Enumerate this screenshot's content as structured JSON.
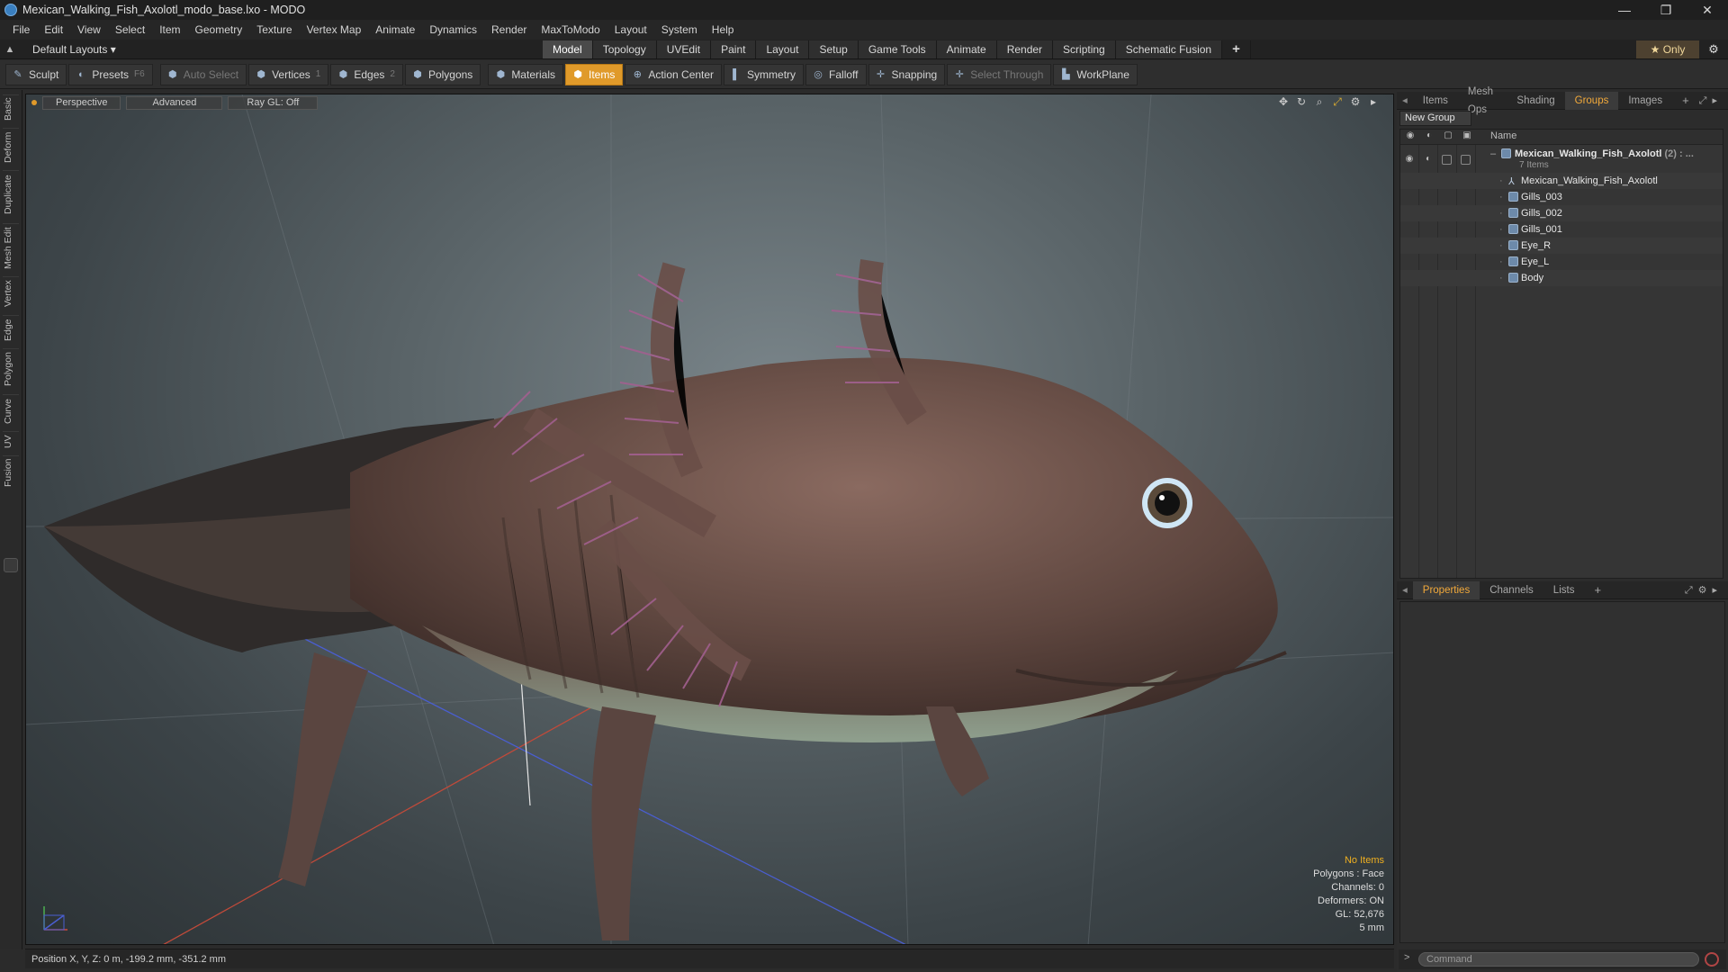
{
  "window": {
    "title": "Mexican_Walking_Fish_Axolotl_modo_base.lxo - MODO",
    "controls": [
      "—",
      "❐",
      "✕"
    ]
  },
  "menu": [
    "File",
    "Edit",
    "View",
    "Select",
    "Item",
    "Geometry",
    "Texture",
    "Vertex Map",
    "Animate",
    "Dynamics",
    "Render",
    "MaxToModo",
    "Layout",
    "System",
    "Help"
  ],
  "layout": {
    "dropdown": "Default Layouts ▾",
    "tabs": [
      "Model",
      "Topology",
      "UVEdit",
      "Paint",
      "Layout",
      "Setup",
      "Game Tools",
      "Animate",
      "Render",
      "Scripting",
      "Schematic Fusion"
    ],
    "active_tab": "Model",
    "plus": "+",
    "only": "★ Only"
  },
  "toolbar": {
    "sculpt": "Sculpt",
    "presets": "Presets",
    "presets_key": "F6",
    "auto_select": "Auto Select",
    "vertices": "Vertices",
    "vertices_count": "1",
    "edges": "Edges",
    "edges_count": "2",
    "polygons": "Polygons",
    "materials": "Materials",
    "items": "Items",
    "action_center": "Action Center",
    "symmetry": "Symmetry",
    "falloff": "Falloff",
    "snapping": "Snapping",
    "select_through": "Select Through",
    "workplane": "WorkPlane"
  },
  "left_tabs": [
    "Basic",
    "Deform",
    "Duplicate",
    "Mesh Edit",
    "Vertex",
    "Edge",
    "Polygon",
    "Curve",
    "UV",
    "Fusion"
  ],
  "viewport": {
    "perspective": "Perspective",
    "advanced": "Advanced",
    "raygl": "Ray GL: Off",
    "stats": {
      "no_items": "No Items",
      "polygons": "Polygons : Face",
      "channels": "Channels: 0",
      "deformers": "Deformers: ON",
      "gl": "GL: 52,676",
      "unit": "5 mm"
    }
  },
  "status": {
    "position": "Position X, Y, Z:  0 m, -199.2 mm, -351.2 mm"
  },
  "right_panel": {
    "top_tabs": [
      "Items",
      "Mesh Ops",
      "Shading",
      "Groups",
      "Images"
    ],
    "active_top": "Groups",
    "new_group": "New Group",
    "name_header": "Name",
    "group": {
      "name": "Mexican_Walking_Fish_Axolotl",
      "count": "(2) : ...",
      "items_label": "7 Items"
    },
    "children": [
      "Mexican_Walking_Fish_Axolotl",
      "Gills_003",
      "Gills_002",
      "Gills_001",
      "Eye_R",
      "Eye_L",
      "Body"
    ],
    "bottom_tabs": [
      "Properties",
      "Channels",
      "Lists"
    ],
    "active_bottom": "Properties",
    "command_placeholder": "Command"
  },
  "colors": {
    "accent": "#f2a93b",
    "active_tool": "#e09a2a",
    "stat_warning": "#f0b020",
    "axolotl_body": "#6a5048",
    "axolotl_gills": "#9a5a8a"
  }
}
